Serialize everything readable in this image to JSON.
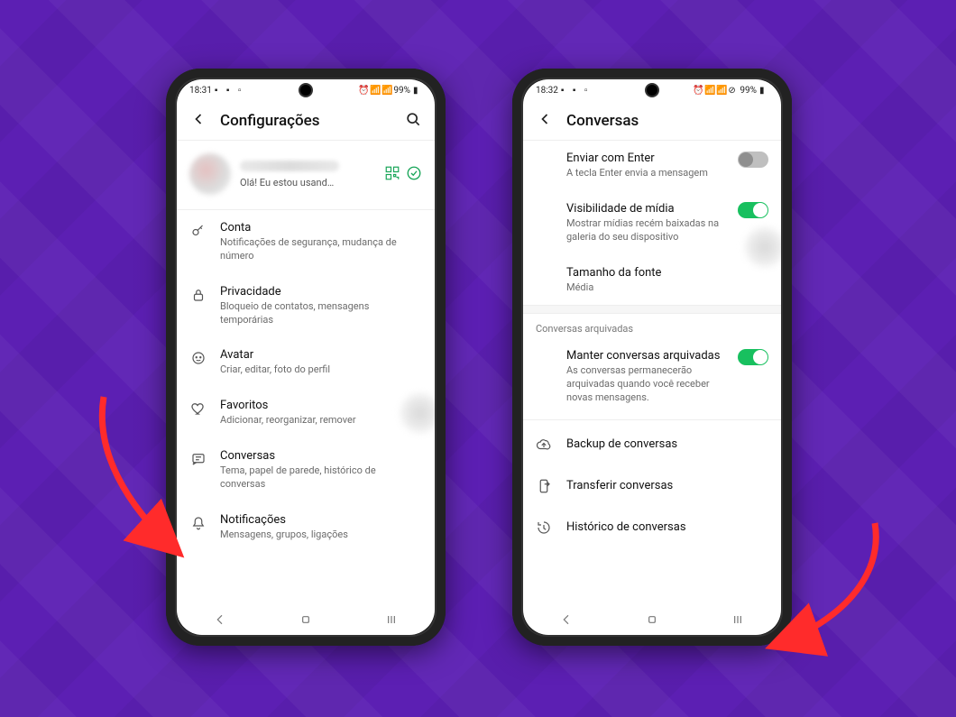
{
  "phone1": {
    "status": {
      "time": "18:31",
      "battery": "99%"
    },
    "header": {
      "title": "Configurações"
    },
    "profile": {
      "subtitle": "Olá! Eu estou usand…"
    },
    "items": [
      {
        "title": "Conta",
        "subtitle": "Notificações de segurança, mudança de número"
      },
      {
        "title": "Privacidade",
        "subtitle": "Bloqueio de contatos, mensagens temporárias"
      },
      {
        "title": "Avatar",
        "subtitle": "Criar, editar, foto do perfil"
      },
      {
        "title": "Favoritos",
        "subtitle": "Adicionar, reorganizar, remover"
      },
      {
        "title": "Conversas",
        "subtitle": "Tema, papel de parede, histórico de conversas"
      },
      {
        "title": "Notificações",
        "subtitle": "Mensagens, grupos, ligações"
      }
    ]
  },
  "phone2": {
    "status": {
      "time": "18:32",
      "battery": "99%"
    },
    "header": {
      "title": "Conversas"
    },
    "rows": {
      "enter": {
        "title": "Enviar com Enter",
        "subtitle": "A tecla Enter envia a mensagem",
        "on": false
      },
      "media": {
        "title": "Visibilidade de mídia",
        "subtitle": "Mostrar mídias recém baixadas na galeria do seu dispositivo",
        "on": true
      },
      "font": {
        "title": "Tamanho da fonte",
        "subtitle": "Média"
      }
    },
    "archived": {
      "section": "Conversas arquivadas",
      "keep": {
        "title": "Manter conversas arquivadas",
        "subtitle": "As conversas permanecerão arquivadas quando você receber novas mensagens.",
        "on": true
      }
    },
    "actions": {
      "backup": "Backup de conversas",
      "transfer": "Transferir conversas",
      "history": "Histórico de conversas"
    }
  }
}
